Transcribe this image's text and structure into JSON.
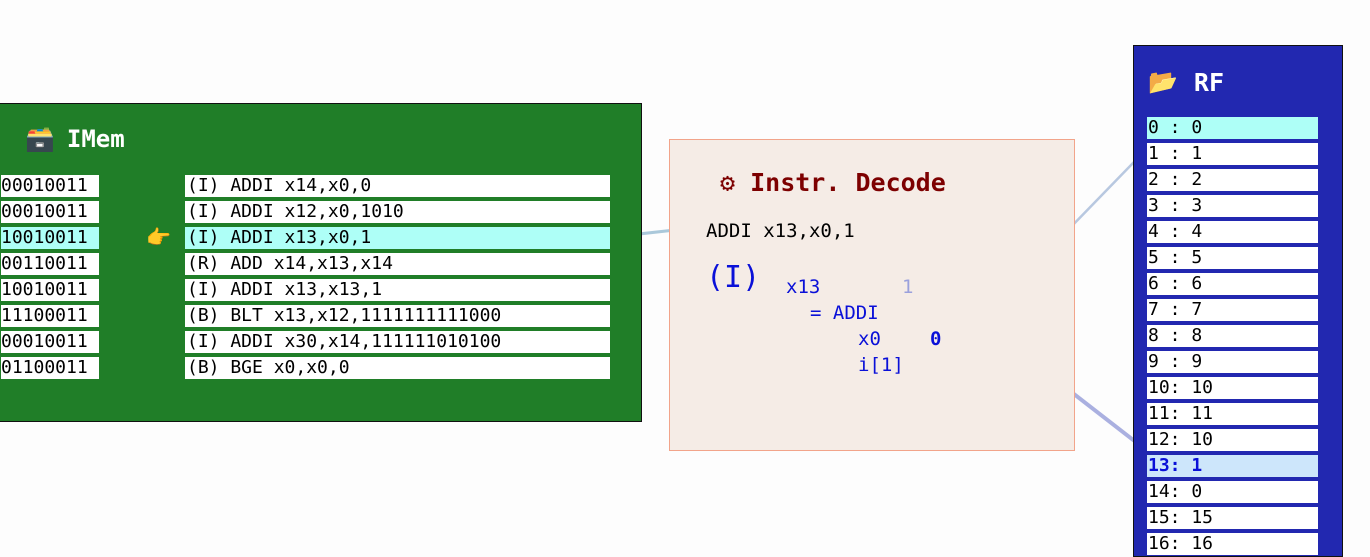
{
  "imem": {
    "title": "IMem",
    "icon": "card-file-box-icon",
    "pc_pointer": "👉",
    "rows": [
      {
        "bin": "00010011",
        "instr": "(I) ADDI x14,x0,0"
      },
      {
        "bin": "00010011",
        "instr": "(I) ADDI x12,x0,1010"
      },
      {
        "bin": "10010011",
        "instr": "(I) ADDI x13,x0,1"
      },
      {
        "bin": "00110011",
        "instr": "(R) ADD x14,x13,x14"
      },
      {
        "bin": "10010011",
        "instr": "(I) ADDI x13,x13,1"
      },
      {
        "bin": "11100011",
        "instr": "(B) BLT x13,x12,1111111111000"
      },
      {
        "bin": "00010011",
        "instr": "(I) ADDI x30,x14,111111010100"
      },
      {
        "bin": "01100011",
        "instr": "(B) BGE x0,x0,0"
      }
    ],
    "active_row": 2
  },
  "decode": {
    "title": "⚙ Instr. Decode",
    "instr": "ADDI x13,x0,1",
    "type": "(I)",
    "rd": "x13",
    "result": "1",
    "op": "= ADDI",
    "rs1": "x0",
    "rs1_value": "0",
    "imm": "i[1]"
  },
  "rf": {
    "title": "RF",
    "icon": "open-folder-icon",
    "regs": [
      "0 : 0",
      "1 : 1",
      "2 : 2",
      "3 : 3",
      "4 : 4",
      "5 : 5",
      "6 : 6",
      "7 : 7",
      "8 : 8",
      "9 : 9",
      "10: 10",
      "11: 11",
      "12: 10",
      "13: 1",
      "14: 0",
      "15: 15",
      "16: 16"
    ],
    "read_reg": 0,
    "write_reg": 13
  },
  "colors": {
    "imem_bg": "#207e28",
    "rf_bg": "#2228b0",
    "decode_bg": "#f5ece6",
    "decode_title": "#7d0000",
    "highlight": "#aefff7",
    "field_blue": "#0a10d8"
  }
}
